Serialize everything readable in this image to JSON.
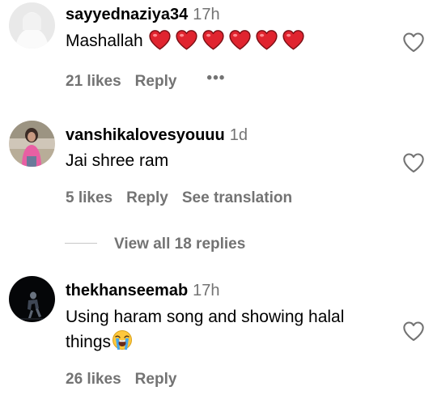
{
  "comments": [
    {
      "username": "sayyednaziya34",
      "time": "17h",
      "text": "Mashallah",
      "emoji_count": 6,
      "likes": "21 likes",
      "reply": "Reply",
      "more": "•••"
    },
    {
      "username": "vanshikalovesyouuu",
      "time": "1d",
      "text": "Jai shree ram",
      "likes": "5 likes",
      "reply": "Reply",
      "translate": "See translation"
    },
    {
      "username": "thekhanseemab",
      "time": "17h",
      "text_line1": "Using haram song and showing halal",
      "text_line2": "things",
      "likes": "26 likes",
      "reply": "Reply"
    }
  ],
  "view_replies": "View all 18 replies",
  "icons": {
    "like": "heart-outline-icon",
    "heart_emoji": "red-heart-emoji",
    "crying_emoji": "loudly-crying-face-emoji"
  },
  "colors": {
    "secondary_text": "#737373",
    "heart_red": "#e0242f",
    "divider": "#c7c7c7"
  }
}
